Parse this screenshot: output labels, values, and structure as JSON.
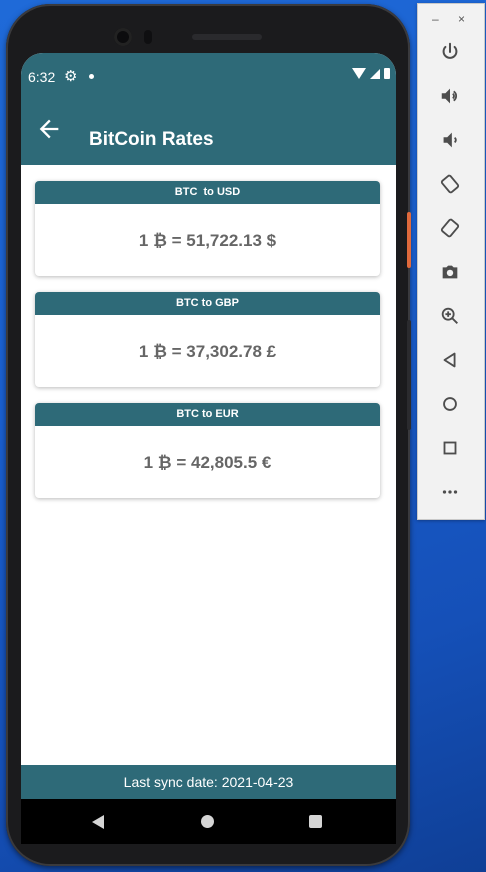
{
  "status_bar": {
    "time": "6:32"
  },
  "app_bar": {
    "title": "BitCoin Rates"
  },
  "rates": [
    {
      "header": "BTC  to USD",
      "value": "1 ₿ = 51,722.13 $"
    },
    {
      "header": "BTC to GBP",
      "value": "1 ₿ = 37,302.78 £"
    },
    {
      "header": "BTC to EUR",
      "value": "1 ₿ = 42,805.5 €"
    }
  ],
  "footer": {
    "text": "Last sync date: 2021-04-23"
  },
  "emulator_toolbar": {
    "window_controls": {
      "minimize": "–",
      "close": "×"
    },
    "buttons": [
      "power-icon",
      "volume-up-icon",
      "volume-down-icon",
      "rotate-left-icon",
      "rotate-right-icon",
      "camera-icon",
      "zoom-icon",
      "back-icon",
      "home-icon",
      "overview-icon",
      "more-icon"
    ]
  },
  "colors": {
    "primary": "#2e6a78",
    "value_text": "#666666",
    "desktop": "#1a5fcf"
  }
}
